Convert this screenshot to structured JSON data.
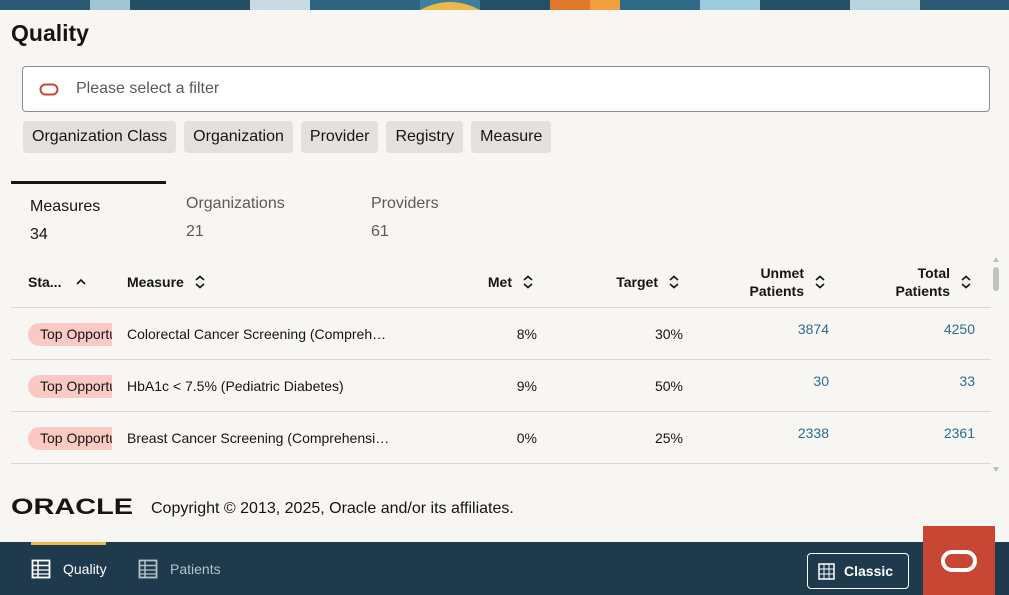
{
  "page": {
    "title": "Quality"
  },
  "filter": {
    "placeholder": "Please select a filter"
  },
  "chips": [
    {
      "label": "Organization Class"
    },
    {
      "label": "Organization"
    },
    {
      "label": "Provider"
    },
    {
      "label": "Registry"
    },
    {
      "label": "Measure"
    }
  ],
  "tabs": [
    {
      "label": "Measures",
      "count": "34",
      "active": true
    },
    {
      "label": "Organizations",
      "count": "21",
      "active": false
    },
    {
      "label": "Providers",
      "count": "61",
      "active": false
    }
  ],
  "table": {
    "columns": {
      "status": "Sta...",
      "measure": "Measure",
      "met": "Met",
      "target": "Target",
      "unmet_1": "Unmet",
      "unmet_2": "Patients",
      "total_1": "Total",
      "total_2": "Patients"
    },
    "rows": [
      {
        "status": "Top Opportunity",
        "measure": "Colorectal Cancer Screening (Comprehe…",
        "met": "8%",
        "target": "30%",
        "unmet": "3874",
        "total": "4250"
      },
      {
        "status": "Top Opportunity",
        "measure": "HbA1c < 7.5% (Pediatric Diabetes)",
        "met": "9%",
        "target": "50%",
        "unmet": "30",
        "total": "33"
      },
      {
        "status": "Top Opportunity",
        "measure": "Breast Cancer Screening (Comprehensi…",
        "met": "0%",
        "target": "25%",
        "unmet": "2338",
        "total": "2361"
      }
    ]
  },
  "footer": {
    "logo_text": "ORACLE",
    "copyright": "Copyright © 2013, 2025, Oracle and/or its affiliates."
  },
  "bottom_nav": {
    "items": [
      {
        "label": "Quality",
        "icon": "table-grid-icon",
        "active": true
      },
      {
        "label": "Patients",
        "icon": "table-grid-icon",
        "active": false
      }
    ],
    "classic_label": "Classic",
    "classic_icon": "grid-icon"
  },
  "colors": {
    "nav_background": "#1f3a4d",
    "active_indicator": "#e9b949",
    "oracle_red": "#c74634",
    "badge_background": "#fbc9c4",
    "link": "#2c6c8f"
  }
}
